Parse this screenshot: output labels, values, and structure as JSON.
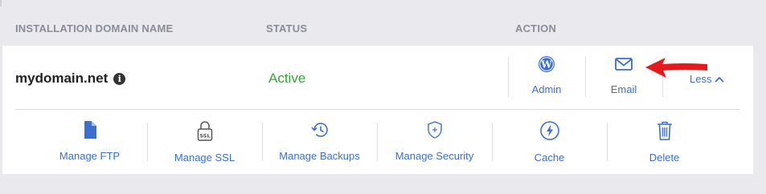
{
  "table": {
    "headers": {
      "domain": "INSTALLATION DOMAIN NAME",
      "status": "STATUS",
      "action": "ACTION"
    }
  },
  "row": {
    "domain": "mydomain.net",
    "info_icon": "i",
    "status": "Active",
    "actions": [
      {
        "label": "Admin",
        "icon": "wordpress-icon"
      },
      {
        "label": "Email",
        "icon": "envelope-icon"
      }
    ],
    "toggle_label": "Less",
    "tools": [
      {
        "label": "Manage FTP",
        "icon": "file-icon"
      },
      {
        "label": "Manage SSL",
        "icon": "ssl-lock-icon"
      },
      {
        "label": "Manage Backups",
        "icon": "history-icon"
      },
      {
        "label": "Manage Security",
        "icon": "shield-icon"
      },
      {
        "label": "Cache",
        "icon": "lightning-icon"
      },
      {
        "label": "Delete",
        "icon": "trash-icon"
      }
    ]
  },
  "colors": {
    "link": "#3b6fcf",
    "active": "#3aa33f",
    "annotation_arrow": "#e8191b"
  }
}
